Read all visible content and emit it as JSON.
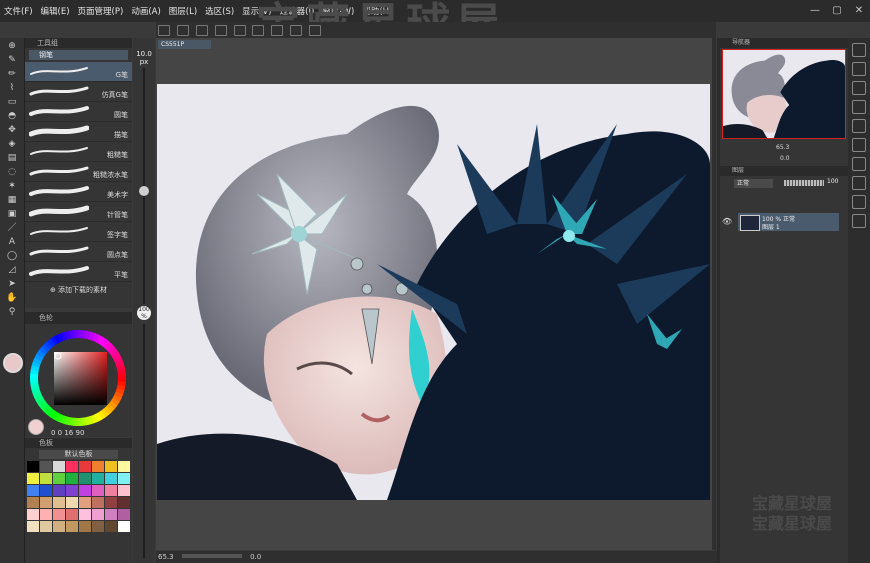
{
  "brand_overlay": "宝藏星球屋",
  "menu": [
    "文件(F)",
    "编辑(E)",
    "页面管理(P)",
    "动画(A)",
    "图层(L)",
    "选区(S)",
    "显示(V)",
    "过滤器(I)",
    "窗口(W)",
    "帮助(H)"
  ],
  "subtool": {
    "header": "工具组",
    "group_tab": "钢笔",
    "brushes": [
      "G笔",
      "仿真G笔",
      "圆笔",
      "描笔",
      "粗糙笔",
      "粗糙浓水笔",
      "美术字",
      "针管笔",
      "签字笔",
      "圆点笔",
      "平笔"
    ],
    "selected_index": 0,
    "add_material": "添加下载的素材"
  },
  "brush_size": {
    "value": "10.0",
    "unit": "px"
  },
  "opacity_badge": {
    "value": "100",
    "unit": "%"
  },
  "color_panel": {
    "header": "色轮",
    "hsv_readout": "0  0  16  90"
  },
  "swatch_panel": {
    "header": "色板",
    "set_name": "默认色板",
    "colors": [
      "#000000",
      "#555555",
      "#d8d8d8",
      "#ff3060",
      "#e83a3a",
      "#f08030",
      "#f0c020",
      "#fff8a0",
      "#f0f040",
      "#c0e040",
      "#60d040",
      "#20b040",
      "#209070",
      "#20b0a0",
      "#40d0e0",
      "#80f0f0",
      "#4080f0",
      "#2050d0",
      "#6040c0",
      "#8040d0",
      "#c040e0",
      "#e060c0",
      "#f080a0",
      "#ffc0d0",
      "#b08050",
      "#d0a070",
      "#e0c090",
      "#f0d8b0",
      "#e0a080",
      "#c07060",
      "#904040",
      "#603030",
      "#ffd0d0",
      "#ffb0b0",
      "#f09090",
      "#e07070",
      "#ffc0e0",
      "#f0a0d0",
      "#d080c0",
      "#b060a0",
      "#f0e0c0",
      "#e0c8a0",
      "#d0b080",
      "#c09860",
      "#a07848",
      "#806040",
      "#604830",
      "#ffffff"
    ]
  },
  "canvas": {
    "tab_name": "CS551P",
    "zoom_status": "65.3",
    "angle_status": "0.0"
  },
  "navigator": {
    "header": "导航器",
    "zoom": "65.3",
    "angle": "0.0"
  },
  "layer_panel": {
    "header": "图层",
    "blend_mode": "正常",
    "opacity": "100",
    "layers": [
      {
        "mode_line": "100 % 正常",
        "name": "图层 1"
      }
    ]
  },
  "watermark": [
    "宝藏星球屋",
    "宝藏星球屋"
  ]
}
